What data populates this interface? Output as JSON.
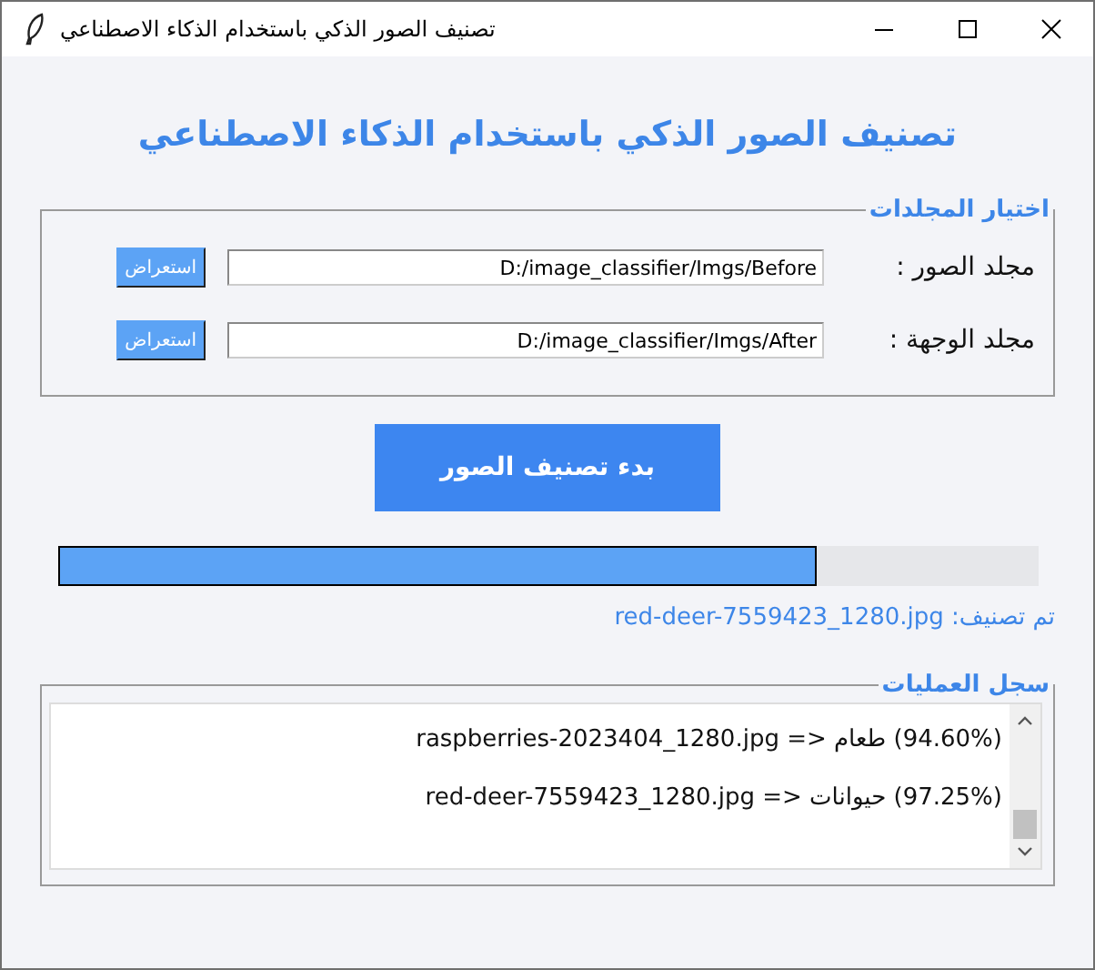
{
  "window": {
    "title": "تصنيف الصور الذكي باستخدام الذكاء الاصطناعي"
  },
  "heading": "تصنيف الصور الذكي باستخدام الذكاء الاصطناعي",
  "folders": {
    "title": "اختيار المجلدات",
    "rows": [
      {
        "label": "مجلد الصور :",
        "value": "D:/image_classifier/Imgs/Before",
        "button": "استعراض"
      },
      {
        "label": "مجلد الوجهة :",
        "value": "D:/image_classifier/Imgs/After",
        "button": "استعراض"
      }
    ]
  },
  "start_button": "بدء تصنيف الصور",
  "progress": {
    "level": 0.77
  },
  "status": "تم تصنيف: red-deer-7559423_1280.jpg",
  "log": {
    "title": "سجل العمليات",
    "lines": [
      {
        "file": "raspberries-2023404_1280.jpg",
        "arrow": "=>",
        "category": "طعام",
        "confidence": "(94.60%)"
      },
      {
        "file": "red-deer-7559423_1280.jpg",
        "arrow": "=>",
        "category": "حيوانات",
        "confidence": "(97.25%)"
      }
    ]
  }
}
